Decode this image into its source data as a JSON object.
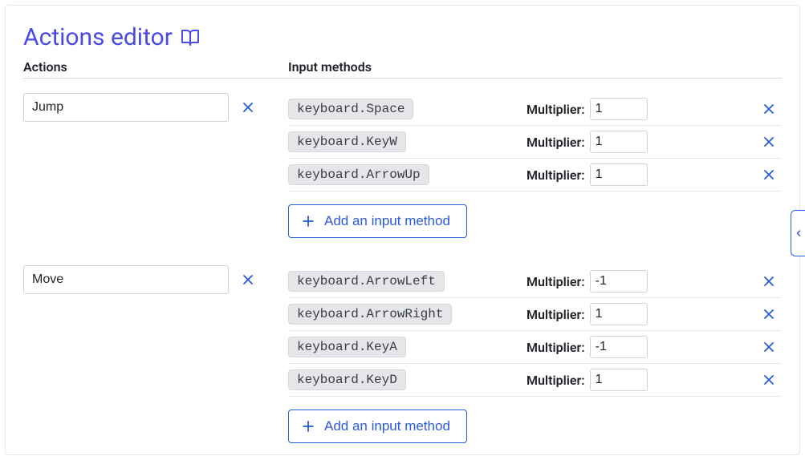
{
  "title": "Actions editor",
  "headers": {
    "actions": "Actions",
    "inputs": "Input methods"
  },
  "multiplierLabel": "Multiplier:",
  "addButtonLabel": "Add an input method",
  "actions": [
    {
      "name": "Jump",
      "inputs": [
        {
          "key": "keyboard.Space",
          "multiplier": "1"
        },
        {
          "key": "keyboard.KeyW",
          "multiplier": "1"
        },
        {
          "key": "keyboard.ArrowUp",
          "multiplier": "1"
        }
      ]
    },
    {
      "name": "Move",
      "inputs": [
        {
          "key": "keyboard.ArrowLeft",
          "multiplier": "-1"
        },
        {
          "key": "keyboard.ArrowRight",
          "multiplier": "1"
        },
        {
          "key": "keyboard.KeyA",
          "multiplier": "-1"
        },
        {
          "key": "keyboard.KeyD",
          "multiplier": "1"
        }
      ]
    }
  ]
}
